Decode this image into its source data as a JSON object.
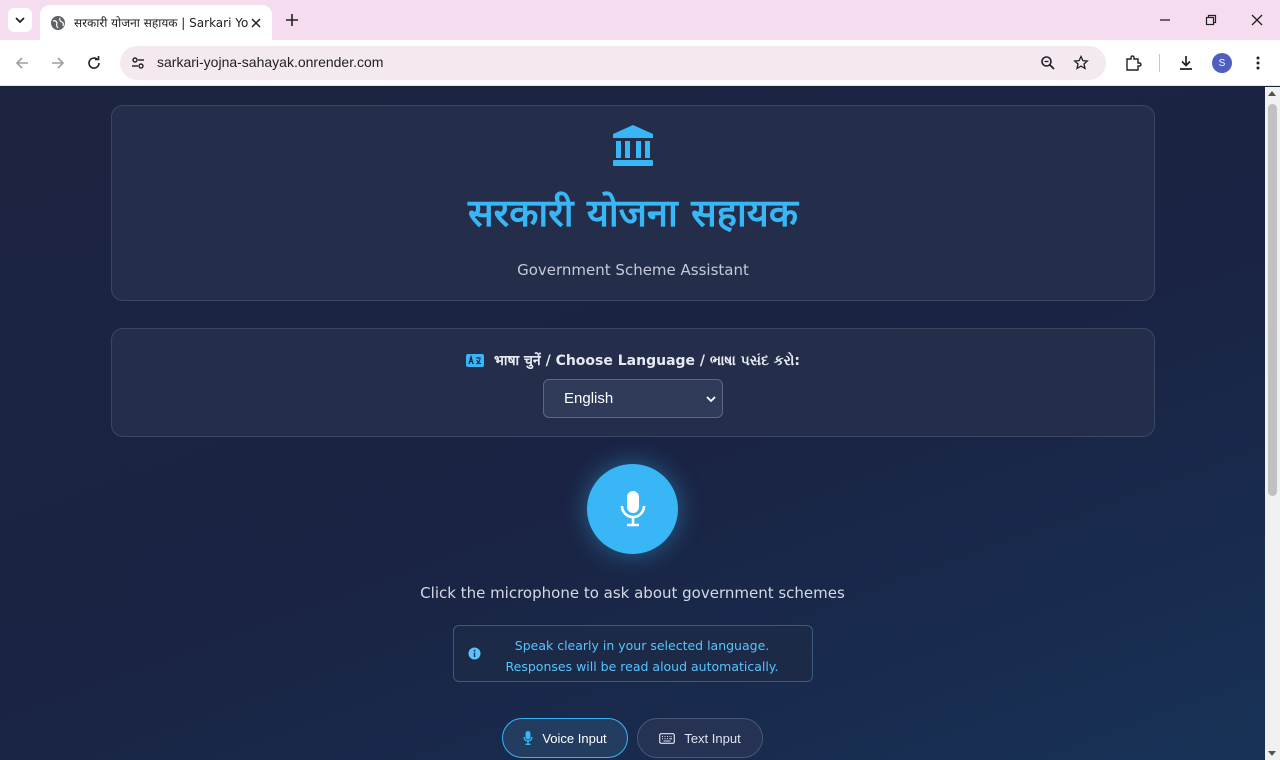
{
  "browser": {
    "tab_title": "सरकारी योजना सहायक | Sarkari Yojna Sahayak",
    "url": "sarkari-yojna-sahayak.onrender.com",
    "profile_initial": "S"
  },
  "header": {
    "title_hindi": "सरकारी योजना सहायक",
    "subtitle": "Government Scheme Assistant",
    "icon": "bank-icon"
  },
  "language": {
    "label": "भाषा चुनें / Choose Language / ભાષા પસંદ કરો:",
    "selected": "English"
  },
  "voice": {
    "instruction": "Click the microphone to ask about government schemes",
    "hint": "Speak clearly in your selected language. Responses will be read aloud automatically."
  },
  "modes": {
    "voice_label": "Voice Input",
    "text_label": "Text Input"
  },
  "colors": {
    "accent": "#38b6f5",
    "background": "#1b2440",
    "tab_strip": "#f5dcef"
  }
}
